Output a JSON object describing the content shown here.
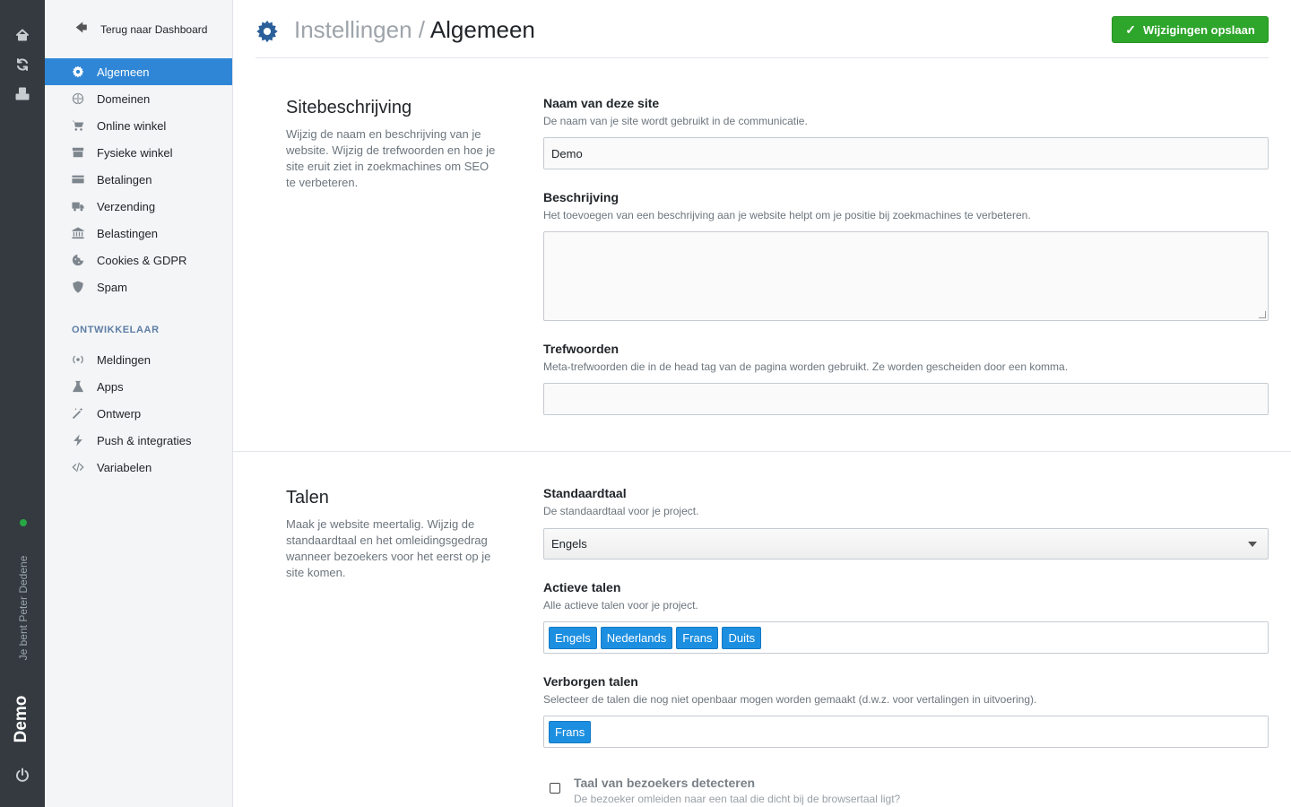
{
  "rail": {
    "icons": [
      "home-icon",
      "sync-icon",
      "boxes-icon",
      "power-icon"
    ],
    "user_text": "Je bent Peter Dedene",
    "site_name": "Demo",
    "status_color": "#28a745"
  },
  "sidebar": {
    "back_label": "Terug naar Dashboard",
    "items": [
      {
        "label": "Algemeen",
        "icon": "gear-icon",
        "active": true
      },
      {
        "label": "Domeinen",
        "icon": "globe-icon"
      },
      {
        "label": "Online winkel",
        "icon": "cart-icon"
      },
      {
        "label": "Fysieke winkel",
        "icon": "store-icon"
      },
      {
        "label": "Betalingen",
        "icon": "credit-card-icon"
      },
      {
        "label": "Verzending",
        "icon": "truck-icon"
      },
      {
        "label": "Belastingen",
        "icon": "bank-icon"
      },
      {
        "label": "Cookies & GDPR",
        "icon": "cookie-icon"
      },
      {
        "label": "Spam",
        "icon": "shield-icon"
      }
    ],
    "dev_header": "ONTWIKKELAAR",
    "dev_items": [
      {
        "label": "Meldingen",
        "icon": "broadcast-icon"
      },
      {
        "label": "Apps",
        "icon": "flask-icon"
      },
      {
        "label": "Ontwerp",
        "icon": "magic-wand-icon"
      },
      {
        "label": "Push & integraties",
        "icon": "bolt-icon"
      },
      {
        "label": "Variabelen",
        "icon": "code-icon"
      }
    ],
    "active_color": "#2f86d6"
  },
  "header": {
    "crumb": "Instellingen",
    "separator": "/",
    "title": "Algemeen",
    "save_label": "Wijzigingen opslaan",
    "save_color": "#2ea52b"
  },
  "site": {
    "title": "Sitebeschrijving",
    "description": "Wijzig de naam en beschrijving van je website. Wijzig de trefwoorden en hoe je site eruit ziet in zoekmachines om SEO te verbeteren.",
    "name_label": "Naam van deze site",
    "name_help": "De naam van je site wordt gebruikt in de communicatie.",
    "name_value": "Demo",
    "desc_label": "Beschrijving",
    "desc_help": "Het toevoegen van een beschrijving aan je website helpt om je positie bij zoekmachines te verbeteren.",
    "desc_value": "",
    "keywords_label": "Trefwoorden",
    "keywords_help": "Meta-trefwoorden die in de head tag van de pagina worden gebruikt. Ze worden gescheiden door een komma.",
    "keywords_value": ""
  },
  "languages": {
    "title": "Talen",
    "description": "Maak je website meertalig. Wijzig de standaardtaal en het omleidingsgedrag wanneer bezoekers voor het eerst op je site komen.",
    "default_label": "Standaardtaal",
    "default_help": "De standaardtaal voor je project.",
    "default_value": "Engels",
    "active_label": "Actieve talen",
    "active_help": "Alle actieve talen voor je project.",
    "active_tags": [
      "Engels",
      "Nederlands",
      "Frans",
      "Duits"
    ],
    "hidden_label": "Verborgen talen",
    "hidden_help": "Selecteer de talen die nog niet openbaar mogen worden gemaakt (d.w.z. voor vertalingen in uitvoering).",
    "hidden_tags": [
      "Frans"
    ],
    "detect_label": "Taal van bezoekers detecteren",
    "detect_help": "De bezoeker omleiden naar een taal die dicht bij de browsertaal ligt?",
    "detect_checked": false,
    "tag_color": "#1d8fe0"
  }
}
